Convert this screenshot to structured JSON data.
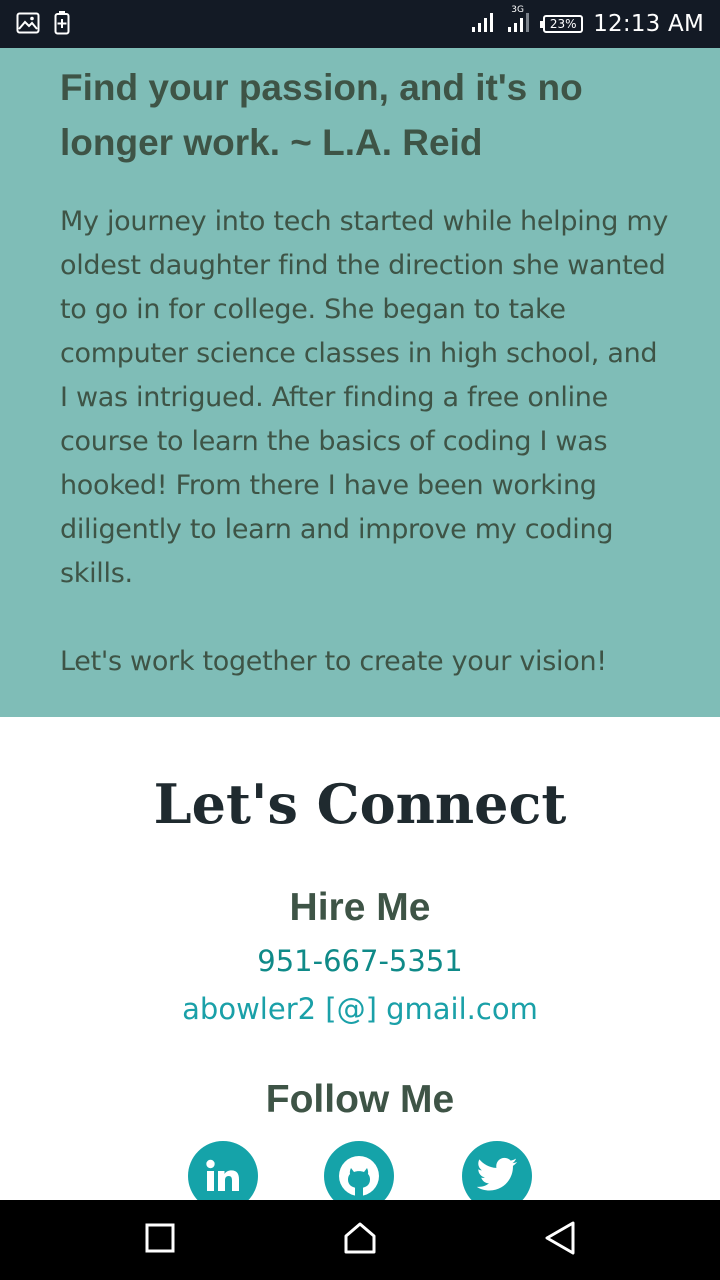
{
  "status_bar": {
    "time": "12:13 AM",
    "battery": "23%",
    "network": "3G",
    "icons": [
      "image-icon",
      "battery-saver-icon",
      "signal-icon",
      "signal-3g-icon",
      "battery-icon"
    ]
  },
  "about": {
    "quote": "Find your passion, and it's no longer work. ~ L.A. Reid",
    "bio": "My journey into tech started while helping my oldest daughter find the direction she wanted to go in for college. She began to take computer science classes in high school, and I was intrigued. After finding a free online course to learn the basics of coding I was hooked! From there I have been working diligently to learn and improve my coding skills.",
    "cta": "Let's work together to create your vision!"
  },
  "connect": {
    "title": "Let's Connect",
    "hire_title": "Hire Me",
    "phone": "951-667-5351",
    "email": "abowler2 [@] gmail.com",
    "follow_title": "Follow Me",
    "social": [
      "linkedin-icon",
      "github-icon",
      "twitter-icon"
    ]
  },
  "colors": {
    "about_bg": "#7fbdb7",
    "text_dark_green": "#3e5446",
    "accent_teal": "#15a3a9",
    "status_bar_bg": "#131a25"
  },
  "nav_bar": {
    "buttons": [
      "recent-apps-icon",
      "home-icon",
      "back-icon"
    ]
  }
}
